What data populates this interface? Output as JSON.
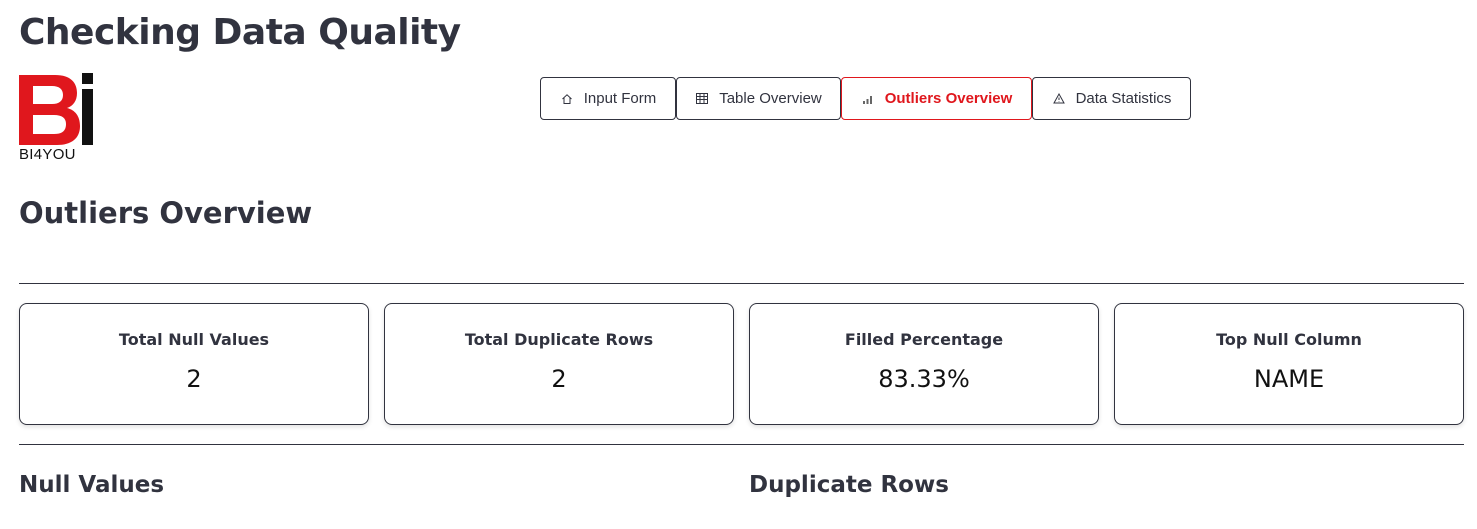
{
  "page": {
    "title": "Checking Data Quality"
  },
  "logo": {
    "text": "BI4YOU",
    "brand_red": "#e0171d",
    "brand_black": "#111111"
  },
  "nav": {
    "tabs": [
      {
        "label": "Input Form",
        "icon": "home-icon",
        "active": false
      },
      {
        "label": "Table Overview",
        "icon": "table-icon",
        "active": false
      },
      {
        "label": "Outliers Overview",
        "icon": "bar-chart-icon",
        "active": true
      },
      {
        "label": "Data Statistics",
        "icon": "warning-icon",
        "active": false
      }
    ],
    "active_color": "#e0171d"
  },
  "section": {
    "title": "Outliers Overview"
  },
  "metrics": [
    {
      "label": "Total Null Values",
      "value": "2"
    },
    {
      "label": "Total Duplicate Rows",
      "value": "2"
    },
    {
      "label": "Filled Percentage",
      "value": "83.33%"
    },
    {
      "label": "Top Null Column",
      "value": "NAME"
    }
  ],
  "subsections": {
    "null_values": "Null Values",
    "duplicate_rows": "Duplicate Rows"
  }
}
